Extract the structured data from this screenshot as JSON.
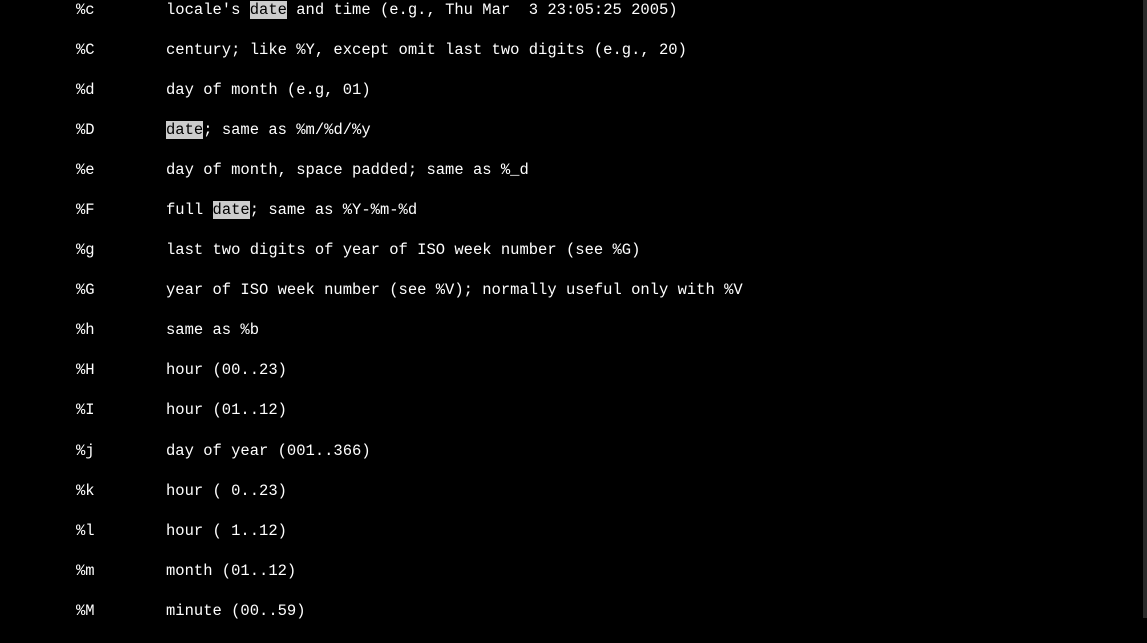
{
  "entries": [
    {
      "code": "%c",
      "segs": [
        {
          "t": "locale's ",
          "hl": false
        },
        {
          "t": "date",
          "hl": true
        },
        {
          "t": " and time (e.g., Thu Mar  3 23:05:25 2005)",
          "hl": false
        }
      ]
    },
    {
      "code": "%C",
      "segs": [
        {
          "t": "century; like %Y, except omit last two digits (e.g., 20)",
          "hl": false
        }
      ]
    },
    {
      "code": "%d",
      "segs": [
        {
          "t": "day of month (e.g, 01)",
          "hl": false
        }
      ]
    },
    {
      "code": "%D",
      "segs": [
        {
          "t": "date",
          "hl": true
        },
        {
          "t": "; same as %m/%d/%y",
          "hl": false
        }
      ]
    },
    {
      "code": "%e",
      "segs": [
        {
          "t": "day of month, space padded; same as %_d",
          "hl": false
        }
      ]
    },
    {
      "code": "%F",
      "segs": [
        {
          "t": "full ",
          "hl": false
        },
        {
          "t": "date",
          "hl": true
        },
        {
          "t": "; same as %Y-%m-%d",
          "hl": false
        }
      ]
    },
    {
      "code": "%g",
      "segs": [
        {
          "t": "last two digits of year of ISO week number (see %G)",
          "hl": false
        }
      ]
    },
    {
      "code": "%G",
      "segs": [
        {
          "t": "year of ISO week number (see %V); normally useful only with %V",
          "hl": false
        }
      ]
    },
    {
      "code": "%h",
      "segs": [
        {
          "t": "same as %b",
          "hl": false
        }
      ]
    },
    {
      "code": "%H",
      "segs": [
        {
          "t": "hour (00..23)",
          "hl": false
        }
      ]
    },
    {
      "code": "%I",
      "segs": [
        {
          "t": "hour (01..12)",
          "hl": false
        }
      ]
    },
    {
      "code": "%j",
      "segs": [
        {
          "t": "day of year (001..366)",
          "hl": false
        }
      ]
    },
    {
      "code": "%k",
      "segs": [
        {
          "t": "hour ( 0..23)",
          "hl": false
        }
      ]
    },
    {
      "code": "%l",
      "segs": [
        {
          "t": "hour ( 1..12)",
          "hl": false
        }
      ]
    },
    {
      "code": "%m",
      "segs": [
        {
          "t": "month (01..12)",
          "hl": false
        }
      ]
    },
    {
      "code": "%M",
      "segs": [
        {
          "t": "minute (00..59)",
          "hl": false
        }
      ]
    }
  ]
}
